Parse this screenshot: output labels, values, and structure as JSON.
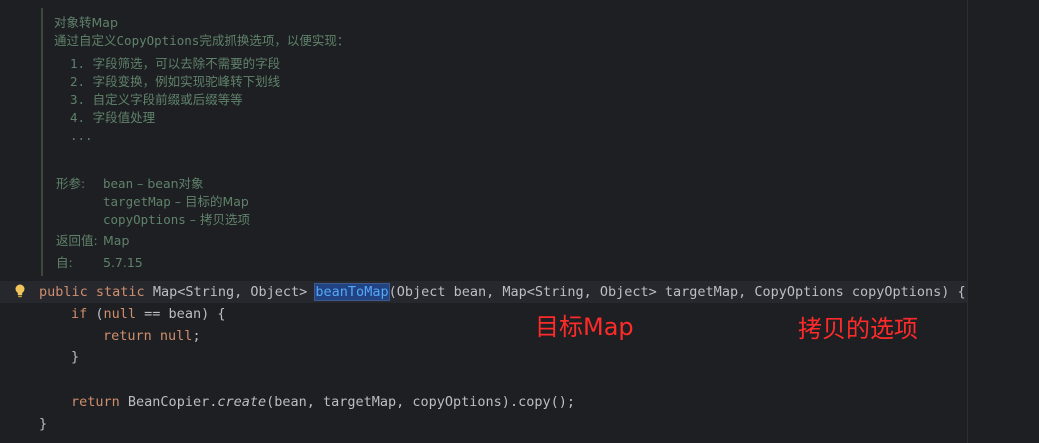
{
  "doc": {
    "title": "对象转Map",
    "description_prefix": "通过自定义",
    "description_code": "CopyOptions",
    "description_suffix": "完成抓换选项，以便实现：",
    "list": [
      "1. 字段筛选，可以去除不需要的字段",
      "2. 字段变换，例如实现驼峰转下划线",
      "3. 自定义字段前缀或后缀等等",
      "4. 字段值处理",
      "..."
    ],
    "params_label": "形参:",
    "params": [
      {
        "name": "bean",
        "desc": "– bean对象"
      },
      {
        "name": "targetMap",
        "desc": "– 目标的Map"
      },
      {
        "name": "copyOptions",
        "desc": "– 拷贝选项"
      }
    ],
    "return_label": "返回值:",
    "return_value": "Map",
    "since_label": "自:",
    "since_value": "5.7.15"
  },
  "code": {
    "line1": {
      "kw_public": "public",
      "kw_static": "static",
      "return_type": "Map<String, Object>",
      "method_name": "beanToMap",
      "params": "(Object bean, Map<String, Object> targetMap, CopyOptions copyOptions) {"
    },
    "line2": {
      "kw_if": "if",
      "open": " (",
      "kw_null": "null",
      "rest": " == bean) {"
    },
    "line3": {
      "kw_return": "return",
      "kw_null": "null",
      "rest": ";"
    },
    "line4": "}",
    "line5": {
      "kw_return": "return",
      "class_name": "BeanCopier.",
      "static_method": "create",
      "rest": "(bean, targetMap, copyOptions).copy();"
    },
    "line6": "}"
  },
  "annotations": {
    "target_map": "目标Map",
    "copy_options": "拷贝的选项"
  },
  "colors": {
    "background": "#1e1f22",
    "doc_comment": "#5f826b",
    "keyword": "#cf8e6d",
    "method": "#56a8f5",
    "text": "#bcbec4",
    "annotation": "#ff2a2a",
    "bulb": "#f2c55c"
  }
}
